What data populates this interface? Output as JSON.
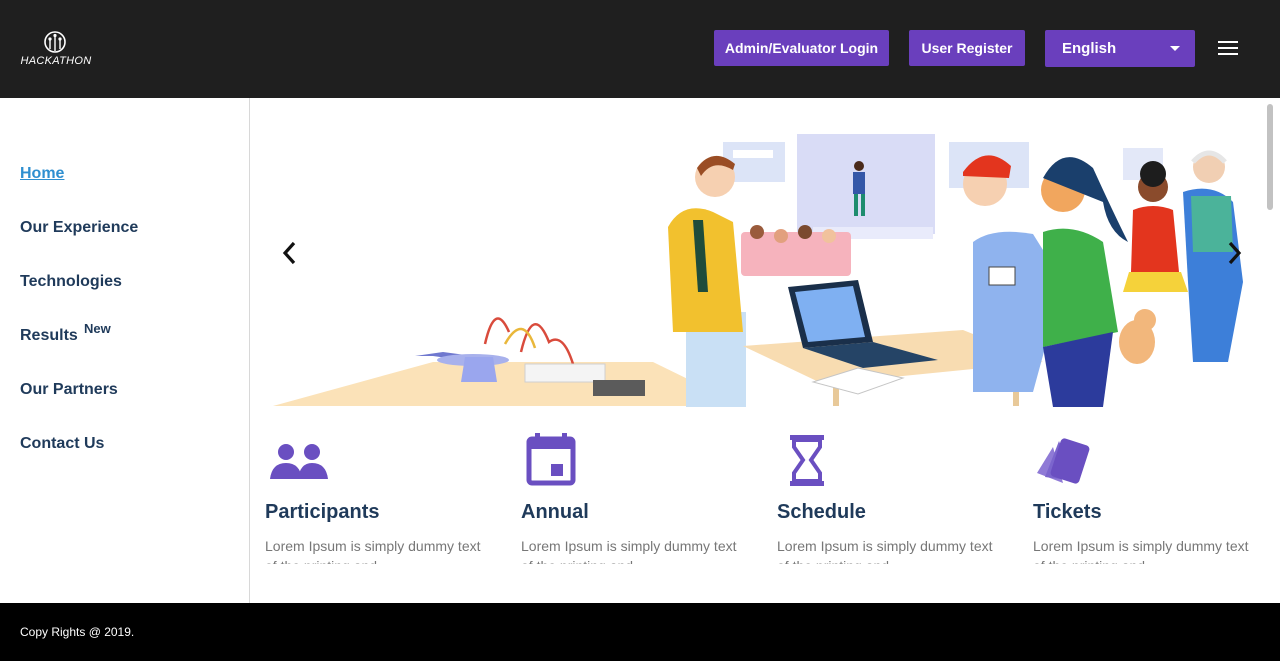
{
  "brand": {
    "logo_text": "HACKATHON",
    "accent": "#6a3fbd",
    "header_bg": "#1f1f1f"
  },
  "header": {
    "admin_login": "Admin/Evaluator Login",
    "user_register": "User Register",
    "language": {
      "selected": "English"
    },
    "menu_icon": "hamburger-icon"
  },
  "sidebar": {
    "items": [
      {
        "label": "Home",
        "active": true
      },
      {
        "label": "Our Experience"
      },
      {
        "label": "Technologies"
      },
      {
        "label": "Results",
        "badge": "New"
      },
      {
        "label": "Our Partners"
      },
      {
        "label": "Contact Us"
      }
    ]
  },
  "carousel": {
    "prev_icon": "chevron-left-icon",
    "next_icon": "chevron-right-icon"
  },
  "features": [
    {
      "icon": "people-icon",
      "title": "Participants",
      "desc": "Lorem Ipsum is simply dummy text of the printing and"
    },
    {
      "icon": "calendar-icon",
      "title": "Annual",
      "desc": "Lorem Ipsum is simply dummy text of the printing and"
    },
    {
      "icon": "hourglass-icon",
      "title": "Schedule",
      "desc": "Lorem Ipsum is simply dummy text of the printing and"
    },
    {
      "icon": "tickets-icon",
      "title": "Tickets",
      "desc": "Lorem Ipsum is simply dummy text of the printing and"
    }
  ],
  "footer": {
    "copyright": "Copy Rights @ 2019."
  }
}
